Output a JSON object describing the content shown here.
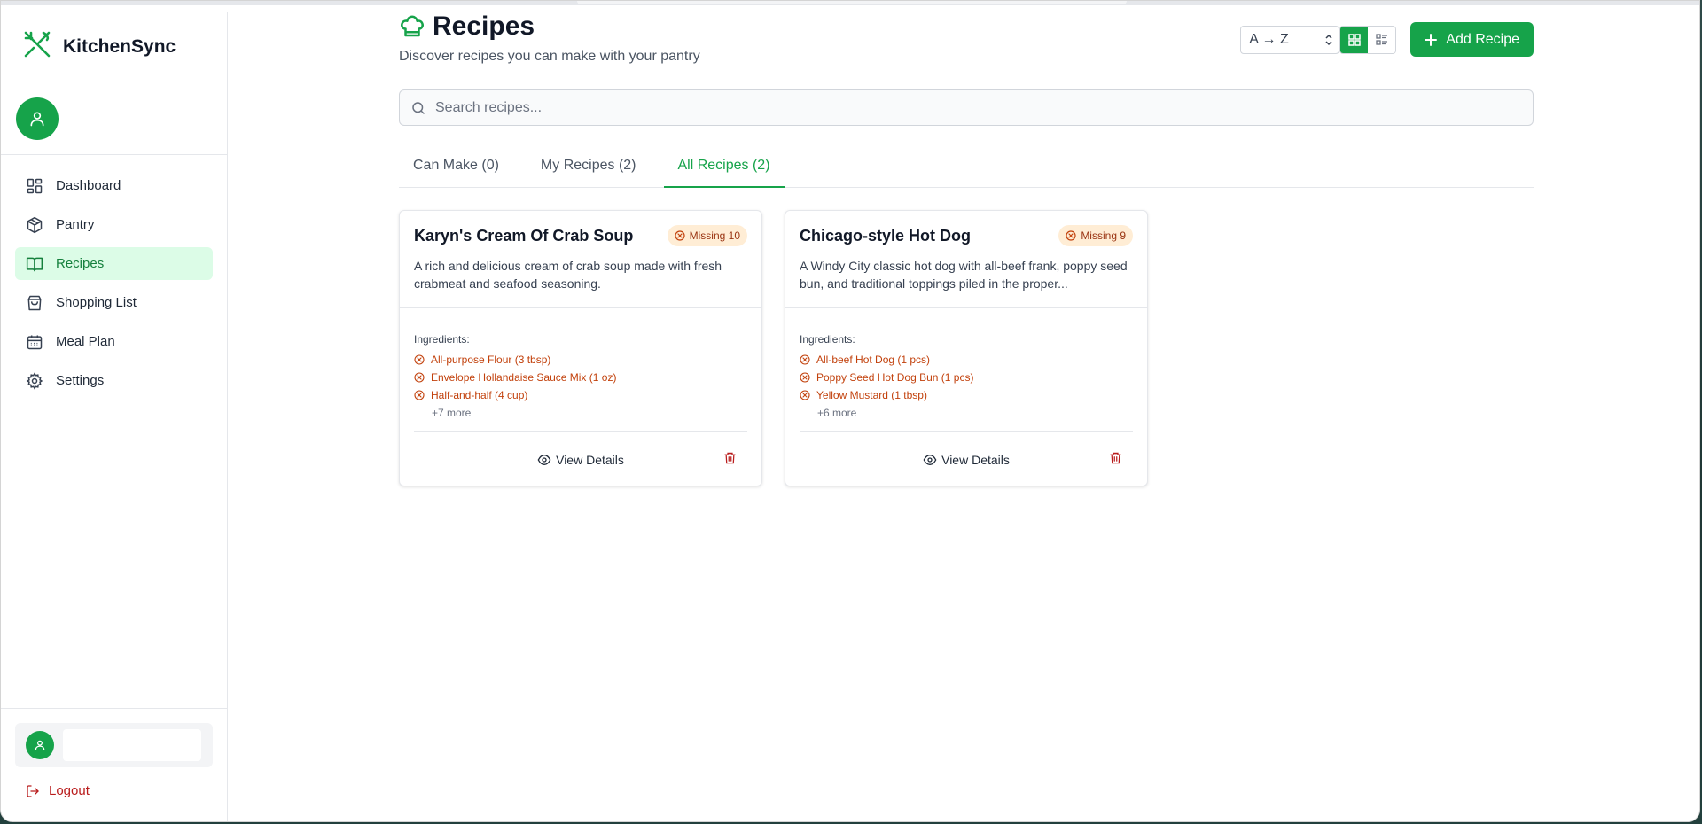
{
  "app": {
    "name": "KitchenSync"
  },
  "colors": {
    "accent": "#16a34a",
    "accent_light": "#dcfce7",
    "danger": "#b91c1c",
    "missing": "#c2410c"
  },
  "sidebar": {
    "items": [
      {
        "label": "Dashboard",
        "icon": "dashboard-icon"
      },
      {
        "label": "Pantry",
        "icon": "box-icon"
      },
      {
        "label": "Recipes",
        "icon": "book-icon",
        "active": true
      },
      {
        "label": "Shopping List",
        "icon": "bag-icon"
      },
      {
        "label": "Meal Plan",
        "icon": "calendar-icon"
      },
      {
        "label": "Settings",
        "icon": "gear-icon"
      }
    ],
    "logout_label": "Logout"
  },
  "header": {
    "title": "Recipes",
    "subtitle": "Discover recipes you can make with your pantry",
    "sort_value": "A → Z",
    "add_label": "Add Recipe"
  },
  "search": {
    "placeholder": "Search recipes..."
  },
  "tabs": [
    {
      "label": "Can Make (0)"
    },
    {
      "label": "My Recipes (2)"
    },
    {
      "label": "All Recipes (2)",
      "active": true
    }
  ],
  "recipes": [
    {
      "title": "Karyn's Cream Of Crab Soup",
      "missing": "Missing 10",
      "description": "A rich and delicious cream of crab soup made with fresh crabmeat and seafood seasoning.",
      "ingredients_label": "Ingredients:",
      "ingredients": [
        "All-purpose Flour (3 tbsp)",
        "Envelope Hollandaise Sauce Mix (1 oz)",
        "Half-and-half (4 cup)"
      ],
      "more": "+7 more",
      "view_label": "View Details"
    },
    {
      "title": "Chicago-style Hot Dog",
      "missing": "Missing 9",
      "description": "A Windy City classic hot dog with all-beef frank, poppy seed bun, and traditional toppings piled in the proper...",
      "ingredients_label": "Ingredients:",
      "ingredients": [
        "All-beef Hot Dog (1 pcs)",
        "Poppy Seed Hot Dog Bun (1 pcs)",
        "Yellow Mustard (1 tbsp)"
      ],
      "more": "+6 more",
      "view_label": "View Details"
    }
  ]
}
